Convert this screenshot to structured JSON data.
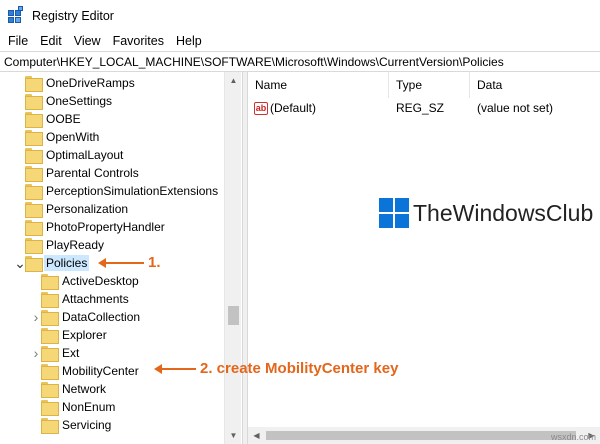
{
  "window": {
    "title": "Registry Editor"
  },
  "menu": [
    "File",
    "Edit",
    "View",
    "Favorites",
    "Help"
  ],
  "address": "Computer\\HKEY_LOCAL_MACHINE\\SOFTWARE\\Microsoft\\Windows\\CurrentVersion\\Policies",
  "tree": [
    {
      "label": "OneDriveRamps",
      "level": 1,
      "expander": ""
    },
    {
      "label": "OneSettings",
      "level": 1,
      "expander": ""
    },
    {
      "label": "OOBE",
      "level": 1,
      "expander": ""
    },
    {
      "label": "OpenWith",
      "level": 1,
      "expander": ""
    },
    {
      "label": "OptimalLayout",
      "level": 1,
      "expander": ""
    },
    {
      "label": "Parental Controls",
      "level": 1,
      "expander": ""
    },
    {
      "label": "PerceptionSimulationExtensions",
      "level": 1,
      "expander": ""
    },
    {
      "label": "Personalization",
      "level": 1,
      "expander": ""
    },
    {
      "label": "PhotoPropertyHandler",
      "level": 1,
      "expander": ""
    },
    {
      "label": "PlayReady",
      "level": 1,
      "expander": ""
    },
    {
      "label": "Policies",
      "level": 1,
      "expander": "expanded",
      "selected": true
    },
    {
      "label": "ActiveDesktop",
      "level": 2,
      "expander": ""
    },
    {
      "label": "Attachments",
      "level": 2,
      "expander": ""
    },
    {
      "label": "DataCollection",
      "level": 2,
      "expander": "collapsed"
    },
    {
      "label": "Explorer",
      "level": 2,
      "expander": ""
    },
    {
      "label": "Ext",
      "level": 2,
      "expander": "collapsed"
    },
    {
      "label": "MobilityCenter",
      "level": 2,
      "expander": ""
    },
    {
      "label": "Network",
      "level": 2,
      "expander": ""
    },
    {
      "label": "NonEnum",
      "level": 2,
      "expander": ""
    },
    {
      "label": "Servicing",
      "level": 2,
      "expander": ""
    }
  ],
  "values_pane": {
    "columns": [
      "Name",
      "Type",
      "Data"
    ],
    "rows": [
      {
        "name": "(Default)",
        "type": "REG_SZ",
        "data": "(value not set)",
        "icon": "string-value-icon"
      }
    ]
  },
  "watermark": "TheWindowsClub",
  "annotations": {
    "step1": "1.",
    "step2": "2. create MobilityCenter key"
  },
  "footer": "wsxdn.com",
  "colors": {
    "annotation": "#e3661a",
    "selection": "#cce8ff",
    "folder": "#f5d777"
  }
}
